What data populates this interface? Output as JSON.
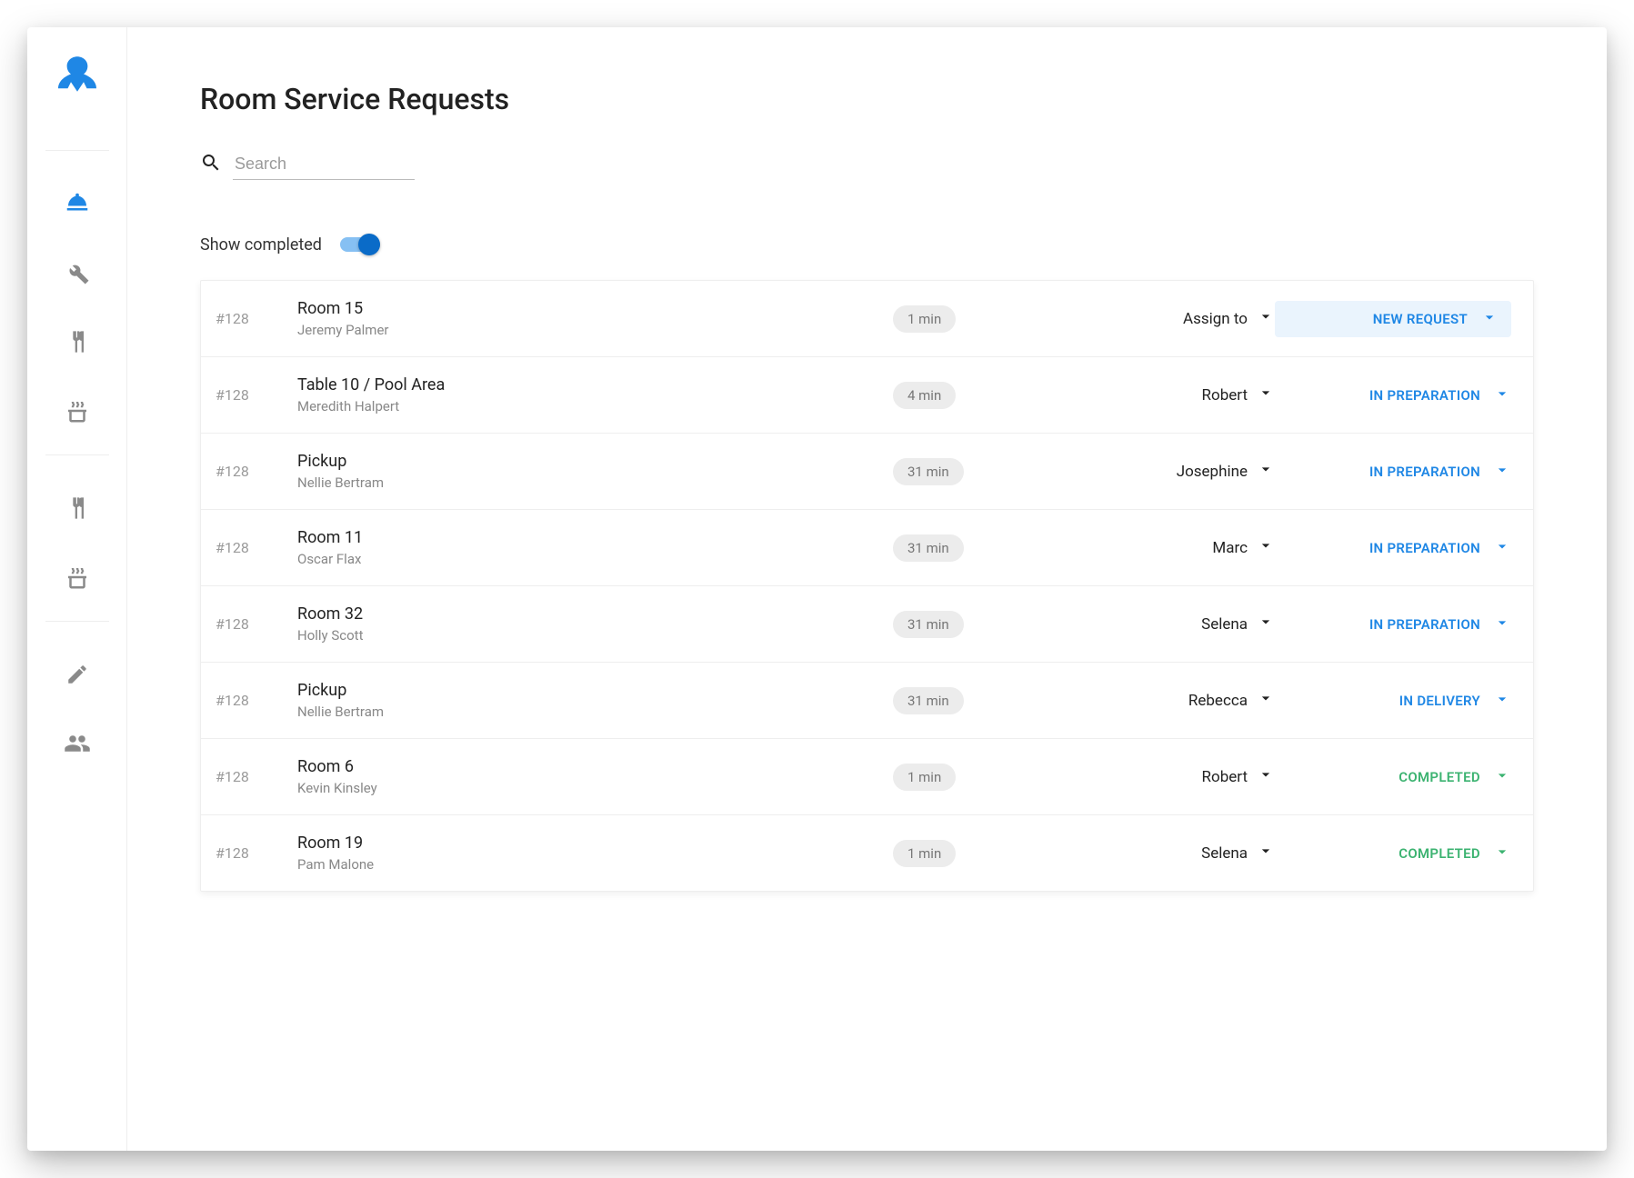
{
  "header": {
    "title": "Room Service Requests"
  },
  "search": {
    "placeholder": "Search",
    "value": ""
  },
  "toggle": {
    "label": "Show completed",
    "on": true
  },
  "statuses": {
    "new": "NEW REQUEST",
    "prep": "IN PREPARATION",
    "delivery": "IN DELIVERY",
    "completed": "COMPLETED"
  },
  "assign_placeholder": "Assign to",
  "rows": [
    {
      "id": "#128",
      "location": "Room 15",
      "guest": "Jeremy Palmer",
      "time": "1 min",
      "assignee": "Assign to",
      "status": "new"
    },
    {
      "id": "#128",
      "location": "Table 10 / Pool Area",
      "guest": "Meredith Halpert",
      "time": "4 min",
      "assignee": "Robert",
      "status": "prep"
    },
    {
      "id": "#128",
      "location": "Pickup",
      "guest": "Nellie Bertram",
      "time": "31 min",
      "assignee": "Josephine",
      "status": "prep"
    },
    {
      "id": "#128",
      "location": "Room 11",
      "guest": "Oscar Flax",
      "time": "31 min",
      "assignee": "Marc",
      "status": "prep"
    },
    {
      "id": "#128",
      "location": "Room 32",
      "guest": "Holly Scott",
      "time": "31 min",
      "assignee": "Selena",
      "status": "prep"
    },
    {
      "id": "#128",
      "location": "Pickup",
      "guest": "Nellie Bertram",
      "time": "31 min",
      "assignee": "Rebecca",
      "status": "delivery"
    },
    {
      "id": "#128",
      "location": "Room 6",
      "guest": "Kevin Kinsley",
      "time": "1 min",
      "assignee": "Robert",
      "status": "completed"
    },
    {
      "id": "#128",
      "location": "Room 19",
      "guest": "Pam Malone",
      "time": "1 min",
      "assignee": "Selena",
      "status": "completed"
    }
  ]
}
